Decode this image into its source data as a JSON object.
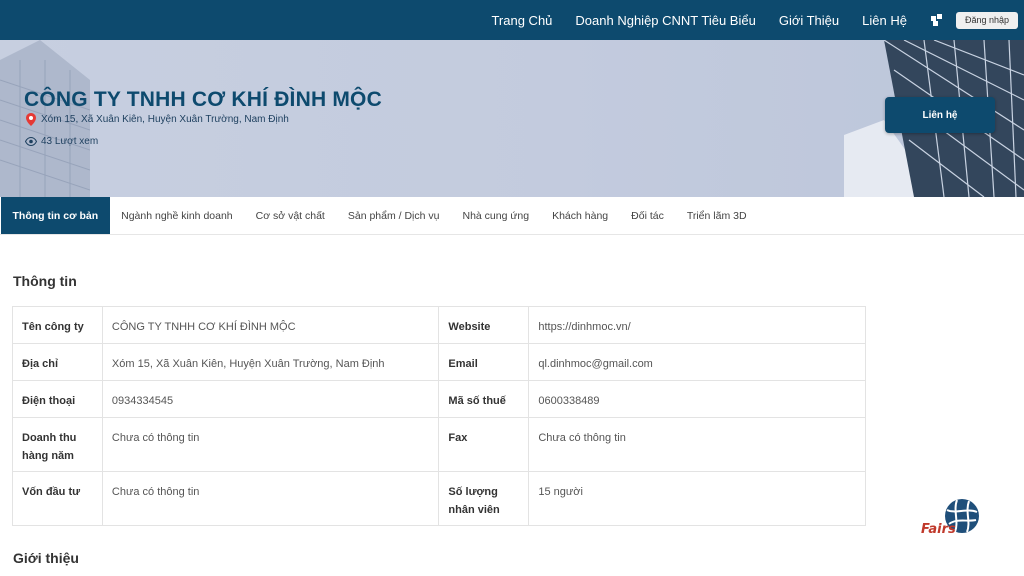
{
  "nav": {
    "items": [
      "Trang Chủ",
      "Doanh Nghiệp CNNT Tiêu Biểu",
      "Giới Thiệu",
      "Liên Hệ"
    ],
    "login_label": "Đăng nhập",
    "icon": "apps-grid-icon"
  },
  "banner": {
    "company_name": "CÔNG TY TNHH CƠ KHÍ ĐÌNH MỘC",
    "address": "Xóm 15, Xã Xuân Kiên, Huyện Xuân Trường, Nam Định",
    "views": "43 Lượt xem",
    "contact_label": "Liên hệ",
    "colors": {
      "primary": "#0d4a6e",
      "pin": "#e53935"
    }
  },
  "tabs": [
    "Thông tin cơ bản",
    "Ngành nghề kinh doanh",
    "Cơ sở vật chất",
    "Sản phẩm / Dịch vụ",
    "Nhà cung ứng",
    "Khách hàng",
    "Đối tác",
    "Triển lãm 3D"
  ],
  "info": {
    "title": "Thông tin",
    "rows": [
      {
        "label1": "Tên công ty",
        "value1": "CÔNG TY TNHH CƠ KHÍ ĐÌNH MỘC",
        "label2": "Website",
        "value2": "https://dinhmoc.vn/"
      },
      {
        "label1": "Địa chỉ",
        "value1": "Xóm 15, Xã Xuân Kiên, Huyện Xuân Trường, Nam Định",
        "label2": "Email",
        "value2": "ql.dinhmoc@gmail.com"
      },
      {
        "label1": "Điện thoại",
        "value1": "0934334545",
        "label2": "Mã số thuế",
        "value2": "0600338489"
      },
      {
        "label1": "Doanh thu hàng năm",
        "value1": "Chưa có thông tin",
        "label2": "Fax",
        "value2": "Chưa có thông tin"
      },
      {
        "label1": "Vốn đầu tư",
        "value1": "Chưa có thông tin",
        "label2": "Số lượng nhân viên",
        "value2": "15 người"
      }
    ]
  },
  "intro": {
    "title": "Giới thiệu"
  },
  "logo": {
    "text": "Fairs"
  }
}
